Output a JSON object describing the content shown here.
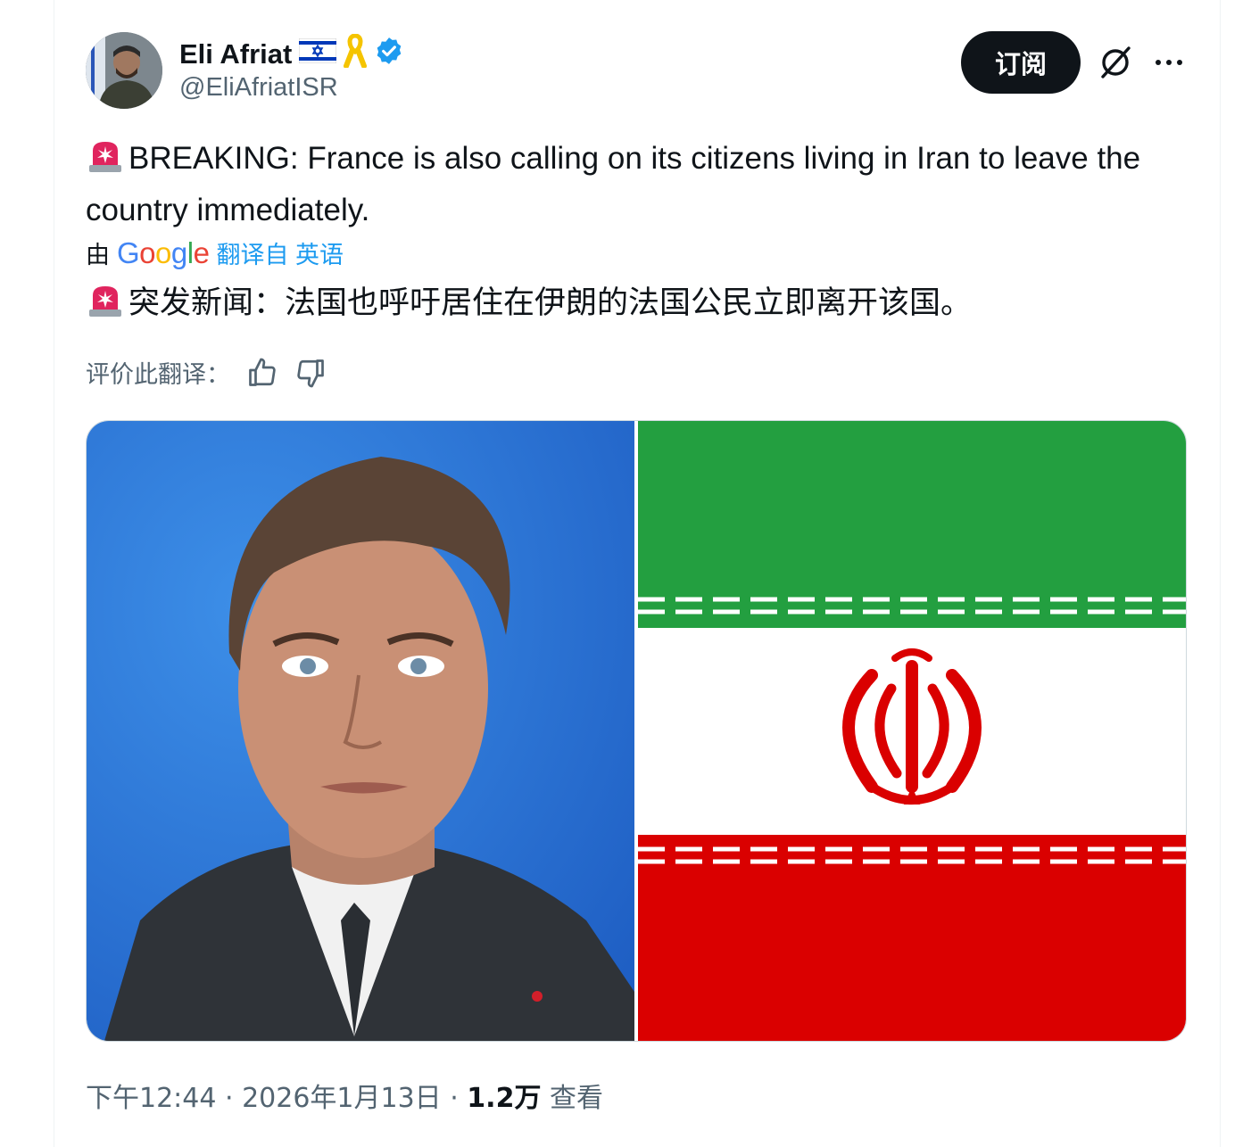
{
  "author": {
    "name": "Eli Afriat",
    "handle": "@EliAfriatISR",
    "badges": [
      "israel-flag-icon",
      "yellow-ribbon-icon",
      "verified-badge-icon"
    ]
  },
  "header": {
    "subscribe_label": "订阅"
  },
  "tweet": {
    "text": "BREAKING: France is also calling on its citizens living in Iran to leave the country immediately.",
    "translated_by_prefix": "由",
    "translated_by_brand": "Google",
    "translate_link": "翻译自 英语",
    "translated_text": "突发新闻：法国也呼吁居住在伊朗的法国公民立即离开该国。",
    "rate_label": "评价此翻译："
  },
  "footer": {
    "time": "下午12:44",
    "separator": " · ",
    "date": "2026年1月13日",
    "views": "1.2万",
    "views_label": "查看"
  },
  "colors": {
    "accent": "#1d9bf0",
    "iran_green": "#239f40",
    "iran_red": "#da0000",
    "photo_bg": "#2f7fe0"
  }
}
